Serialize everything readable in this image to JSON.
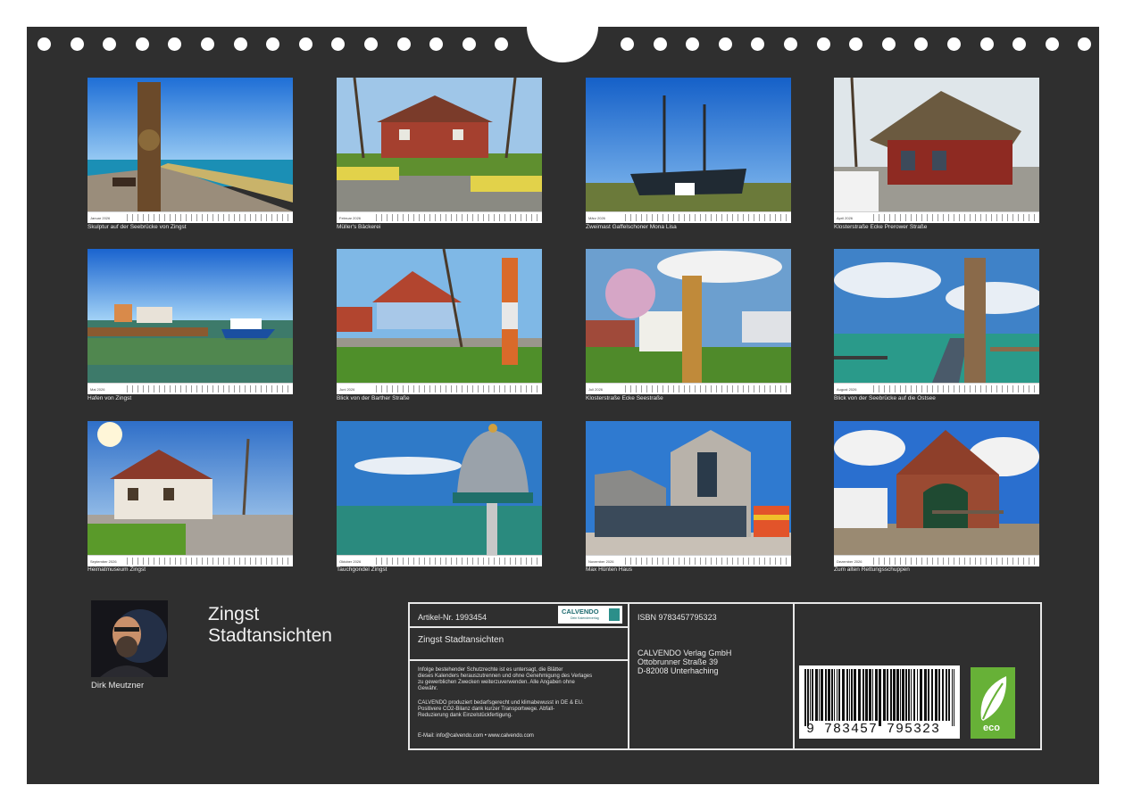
{
  "photos": [
    {
      "month": "Januar 2026",
      "caption": "Skulptur auf der Seebrücke von Zingst"
    },
    {
      "month": "Februar 2026",
      "caption": "Müller's Bäckerei"
    },
    {
      "month": "März 2026",
      "caption": "Zweimast Gaffelschoner Mona Lisa"
    },
    {
      "month": "April 2026",
      "caption": "Klosterstraße Ecke Prerower Straße"
    },
    {
      "month": "Mai 2026",
      "caption": "Hafen von Zingst"
    },
    {
      "month": "Juni 2026",
      "caption": "Blick von der Barther Straße"
    },
    {
      "month": "Juli 2026",
      "caption": "Klosterstraße Ecke Seestraße"
    },
    {
      "month": "August 2026",
      "caption": "Blick von der Seebrücke auf die Ostsee"
    },
    {
      "month": "September 2026",
      "caption": "Heimatmuseum Zingst"
    },
    {
      "month": "Oktober 2026",
      "caption": "Tauchgondel Zingst"
    },
    {
      "month": "November 2026",
      "caption": "Max Hünten Haus"
    },
    {
      "month": "Dezember 2026",
      "caption": "Zum alten Rettungsschuppen"
    }
  ],
  "author": {
    "name": "Dirk Meutzner"
  },
  "calendar": {
    "title_line1": "Zingst",
    "title_line2": "Stadtansichten"
  },
  "info": {
    "article": "Artikel-Nr. 1993454",
    "logo_text": "CALVENDO",
    "logo_sub": "Dein Kalenderverlag",
    "product_name": "Zingst Stadtansichten",
    "legal1": [
      "Infolge bestehender Schutzrechte ist es untersagt, die Blätter",
      "dieses Kalenders herauszutrennen und ohne Genehmigung des Verlages",
      "zu gewerblichen Zwecken weiterzuverwenden. Alle Angaben ohne",
      "Gewähr."
    ],
    "legal2": [
      "CALVENDO produziert bedarfsgerecht und klimabewusst in DE & EU.",
      "Positivere CO2-Bilanz dank kurzer Transportwege. Abfall-",
      "Reduzierung dank Einzelstückfertigung."
    ],
    "contact": "E-Mail: info@calvendo.com • www.calvendo.com",
    "isbn": "ISBN 9783457795323",
    "publisher": [
      "CALVENDO Verlag GmbH",
      "Ottobrunner Straße 39",
      "D-82008 Unterhaching"
    ],
    "barcode_digits": "9 783457 795323",
    "eco_label": "eco"
  }
}
